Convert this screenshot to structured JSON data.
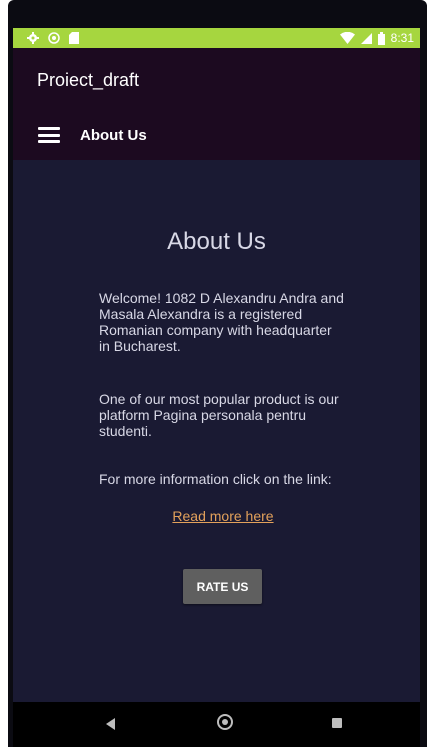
{
  "status_bar": {
    "time": "8:31",
    "icons": [
      "gear-icon",
      "record-icon",
      "sd-card-icon",
      "wifi-icon",
      "signal-icon",
      "battery-icon"
    ]
  },
  "app_bar": {
    "title": "Proiect_draft"
  },
  "toolbar": {
    "menu_icon": "hamburger-menu-icon",
    "title": "About Us"
  },
  "main": {
    "heading": "About Us",
    "paragraph_1": "Welcome! 1082 D Alexandru Andra and Masala Alexandra is a registered Romanian company with headquarter in Bucharest.",
    "paragraph_2": "One of our most popular product is our platform Pagina personala pentru studenti.",
    "paragraph_3": "For more information click on the link:",
    "link_label": "Read more here",
    "rate_button_label": "RATE US"
  },
  "nav_bar": {
    "icons": [
      "back-icon",
      "home-icon",
      "recent-apps-icon"
    ]
  },
  "colors": {
    "status_bar": "#a6d63f",
    "app_bar": "#1c0a20",
    "content_background": "#1a1a33",
    "link": "#e3a15b",
    "button": "#5f5f5f"
  }
}
